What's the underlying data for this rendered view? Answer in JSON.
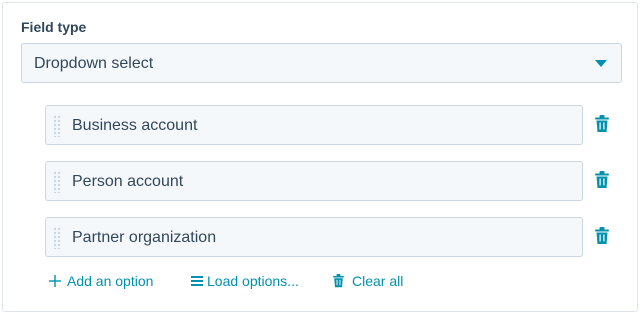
{
  "field": {
    "label": "Field type",
    "selected_value": "Dropdown select"
  },
  "options": [
    {
      "label": "Business account"
    },
    {
      "label": "Person account"
    },
    {
      "label": "Partner organization"
    }
  ],
  "actions": {
    "add_label": "Add an option",
    "load_label": "Load options...",
    "clear_label": "Clear all"
  },
  "colors": {
    "accent": "#0091ae",
    "text": "#33475b",
    "input_bg": "#f5f8fa",
    "border": "#cbd6e2"
  },
  "icons": [
    "caret-down-icon",
    "drag-handle-icon",
    "trash-icon",
    "plus-icon",
    "list-icon"
  ]
}
